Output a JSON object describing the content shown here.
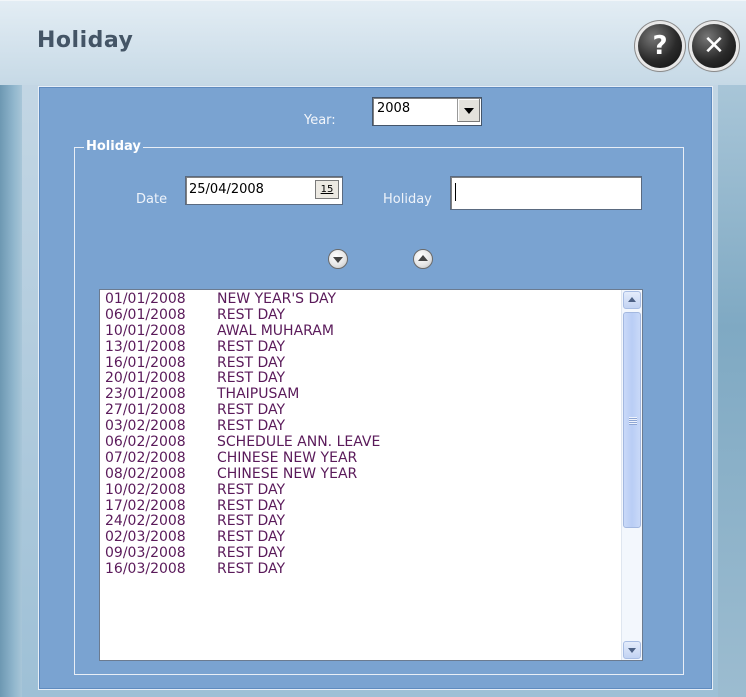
{
  "window": {
    "title": "Holiday",
    "help_label": "?",
    "close_label": "✕"
  },
  "form": {
    "year_label": "Year:",
    "year_value": "2008",
    "group_label": "Holiday",
    "date_label": "Date",
    "date_value": "25/04/2008",
    "calendar_button_label": "15",
    "holiday_label": "Holiday",
    "holiday_value": ""
  },
  "holidays": [
    {
      "date": "01/01/2008",
      "name": "NEW YEAR'S DAY"
    },
    {
      "date": "06/01/2008",
      "name": "REST DAY"
    },
    {
      "date": "10/01/2008",
      "name": "AWAL MUHARAM"
    },
    {
      "date": "13/01/2008",
      "name": "REST DAY"
    },
    {
      "date": "16/01/2008",
      "name": "REST DAY"
    },
    {
      "date": "20/01/2008",
      "name": "REST DAY"
    },
    {
      "date": "23/01/2008",
      "name": "THAIPUSAM"
    },
    {
      "date": "27/01/2008",
      "name": "REST DAY"
    },
    {
      "date": "03/02/2008",
      "name": "REST DAY"
    },
    {
      "date": "06/02/2008",
      "name": "SCHEDULE ANN. LEAVE"
    },
    {
      "date": "07/02/2008",
      "name": "CHINESE NEW YEAR"
    },
    {
      "date": "08/02/2008",
      "name": "CHINESE NEW YEAR"
    },
    {
      "date": "10/02/2008",
      "name": "REST DAY"
    },
    {
      "date": "17/02/2008",
      "name": "REST DAY"
    },
    {
      "date": "24/02/2008",
      "name": "REST DAY"
    },
    {
      "date": "02/03/2008",
      "name": "REST DAY"
    },
    {
      "date": "09/03/2008",
      "name": "REST DAY"
    },
    {
      "date": "16/03/2008",
      "name": "REST DAY"
    }
  ],
  "colors": {
    "panel": "#7aa3d1",
    "list_text": "#5a1a5a"
  }
}
